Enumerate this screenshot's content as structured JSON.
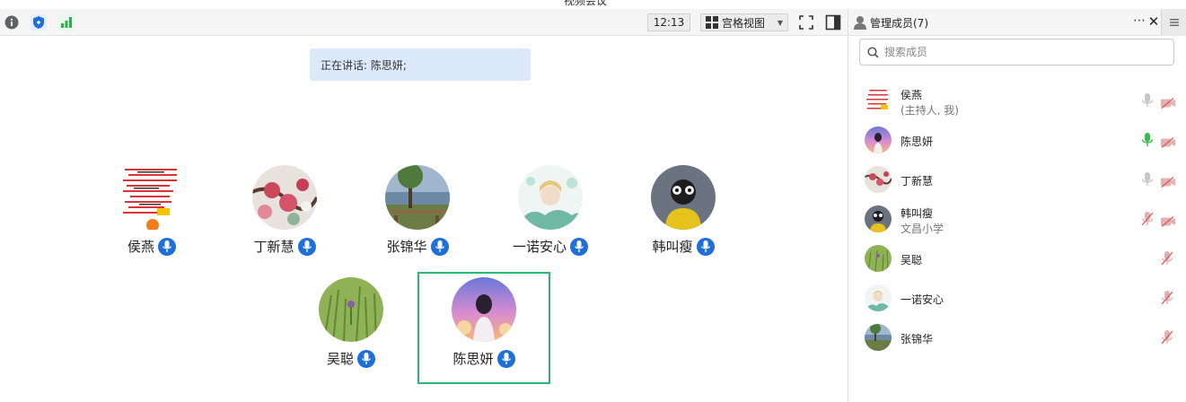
{
  "window": {
    "title": "视频会议"
  },
  "toolbar": {
    "info_icon": "info-icon",
    "security_icon": "shield-icon",
    "network_icon": "signal-bars-icon",
    "time": "12:13",
    "view_mode": "宫格视图",
    "fullscreen_icon": "fullscreen-icon",
    "panel_toggle_icon": "panel-toggle-icon"
  },
  "speaking": {
    "text": "正在讲话: 陈思妍;"
  },
  "participants": [
    {
      "name": "侯燕",
      "host": true
    },
    {
      "name": "丁新慧"
    },
    {
      "name": "张锦华"
    },
    {
      "name": "一诺安心"
    },
    {
      "name": "韩叫瘦"
    },
    {
      "name": "吴聪"
    },
    {
      "name": "陈思妍",
      "selected": true
    }
  ],
  "panel": {
    "title": "管理成员(7)",
    "search_placeholder": "搜索成员",
    "members": [
      {
        "name": "侯燕",
        "sub": "(主持人, 我)",
        "mic": "idle",
        "camera": "off"
      },
      {
        "name": "陈思妍",
        "sub": "",
        "mic": "speaking",
        "camera": "off"
      },
      {
        "name": "丁新慧",
        "sub": "",
        "mic": "idle",
        "camera": "off"
      },
      {
        "name": "韩叫瘦",
        "sub": "文昌小学",
        "mic": "muted",
        "camera": "off"
      },
      {
        "name": "吴聪",
        "sub": "",
        "mic": "muted",
        "camera": "none"
      },
      {
        "name": "一诺安心",
        "sub": "",
        "mic": "muted",
        "camera": "none"
      },
      {
        "name": "张锦华",
        "sub": "",
        "mic": "muted",
        "camera": "none"
      }
    ]
  },
  "colors": {
    "accent": "#1e6fd9",
    "speaking_bg": "#dbe9fb",
    "selected_border": "#2bb673",
    "mic_active": "#3dbb4a"
  }
}
